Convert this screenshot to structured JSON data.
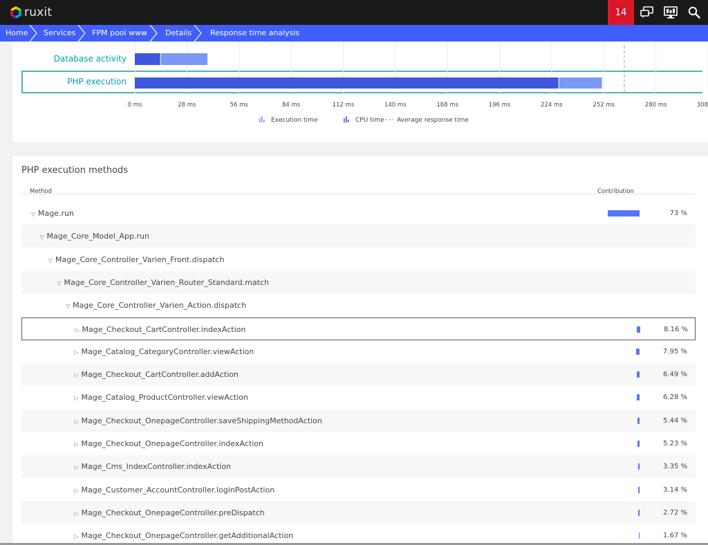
{
  "app": {
    "brand": "ruxit",
    "notification_count": "14"
  },
  "toolbar_icons": [
    "chat-icon",
    "monitor-icon",
    "search-icon"
  ],
  "breadcrumbs": [
    "Home",
    "Services",
    "FPM pool www",
    "Details",
    "Response time analysis"
  ],
  "chart": {
    "rows": [
      "Database activity",
      "PHP execution"
    ],
    "x_ticks": [
      "0 ms",
      "28 ms",
      "56 ms",
      "84 ms",
      "112 ms",
      "140 ms",
      "168 ms",
      "196 ms",
      "224 ms",
      "252 ms",
      "280 ms",
      "308"
    ],
    "legend": [
      "Execution time",
      "CPU time",
      "Average response time"
    ]
  },
  "chart_data": {
    "type": "bar",
    "orientation": "horizontal",
    "stacked": true,
    "categories": [
      "Database activity",
      "PHP execution"
    ],
    "series": [
      {
        "name": "CPU time",
        "values": [
          14,
          228
        ]
      },
      {
        "name": "Execution time",
        "values": [
          25,
          23
        ]
      }
    ],
    "average_response_time": 263,
    "xlim": [
      0,
      308
    ],
    "x_ticks": [
      0,
      28,
      56,
      84,
      112,
      140,
      168,
      196,
      224,
      252,
      280,
      308
    ],
    "legend_placement": "bottom",
    "colors": {
      "cpu": "#3e57dc",
      "execution": "#7b98f7",
      "average": "#999999"
    }
  },
  "methods": {
    "title": "PHP execution methods",
    "col_method": "Method",
    "col_contribution": "Contribution",
    "rows": [
      {
        "name": "Mage.run",
        "level": 0,
        "expanded": true,
        "pct": "73 %",
        "value": 73
      },
      {
        "name": "Mage_Core_Model_App.run",
        "level": 1,
        "expanded": true,
        "pct": "",
        "value": 0
      },
      {
        "name": "Mage_Core_Controller_Varien_Front.dispatch",
        "level": 2,
        "expanded": true,
        "pct": "",
        "value": 0
      },
      {
        "name": "Mage_Core_Controller_Varien_Router_Standard.match",
        "level": 3,
        "expanded": true,
        "pct": "",
        "value": 0
      },
      {
        "name": "Mage_Core_Controller_Varien_Action.dispatch",
        "level": 4,
        "expanded": true,
        "pct": "",
        "value": 0
      },
      {
        "name": "Mage_Checkout_CartController.indexAction",
        "level": 5,
        "expanded": false,
        "pct": "8.16 %",
        "value": 8.16,
        "selected": true
      },
      {
        "name": "Mage_Catalog_CategoryController.viewAction",
        "level": 5,
        "expanded": false,
        "pct": "7.95 %",
        "value": 7.95
      },
      {
        "name": "Mage_Checkout_CartController.addAction",
        "level": 5,
        "expanded": false,
        "pct": "6.49 %",
        "value": 6.49
      },
      {
        "name": "Mage_Catalog_ProductController.viewAction",
        "level": 5,
        "expanded": false,
        "pct": "6.28 %",
        "value": 6.28
      },
      {
        "name": "Mage_Checkout_OnepageController.saveShippingMethodAction",
        "level": 5,
        "expanded": false,
        "pct": "5.44 %",
        "value": 5.44
      },
      {
        "name": "Mage_Checkout_OnepageController.indexAction",
        "level": 5,
        "expanded": false,
        "pct": "5.23 %",
        "value": 5.23
      },
      {
        "name": "Mage_Cms_IndexController.indexAction",
        "level": 5,
        "expanded": false,
        "pct": "3.35 %",
        "value": 3.35
      },
      {
        "name": "Mage_Customer_AccountController.loginPostAction",
        "level": 5,
        "expanded": false,
        "pct": "3.14 %",
        "value": 3.14
      },
      {
        "name": "Mage_Checkout_OnepageController.preDispatch",
        "level": 5,
        "expanded": false,
        "pct": "2.72 %",
        "value": 2.72
      },
      {
        "name": "Mage_Checkout_OnepageController.getAdditionalAction",
        "level": 5,
        "expanded": false,
        "pct": "1.67 %",
        "value": 1.67
      }
    ]
  },
  "colors": {
    "brand_blue": "#3f5efb",
    "alert_red": "#dc172a",
    "teal": "#00a1b2",
    "bar": "#5577f5"
  }
}
